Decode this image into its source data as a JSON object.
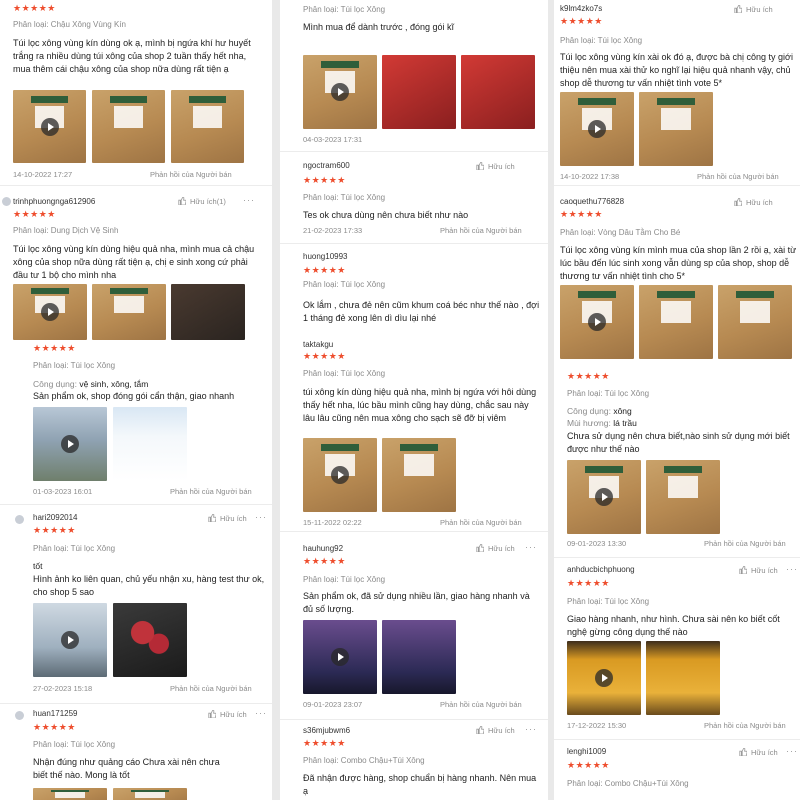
{
  "labels": {
    "category_prefix": "Phân loại:",
    "reply": "Phản hồi của Người bán",
    "helpful": "Hữu ích",
    "use_label": "Công dụng:",
    "scent_label": "Mùi hương:",
    "more": "···",
    "stars": "★★★★★"
  },
  "column1": [
    {
      "user": "",
      "category": "Phân loại: Chậu Xông Vùng Kín",
      "text": "Túi lọc xông vùng kín dùng ok ạ, mình bị ngứa khí hư huyết trắng ra nhiều dùng túi xông của shop 2 tuần thấy hết nha, mua thêm cái chậu xông của shop nữa dùng rất tiện ạ",
      "date": "14-10-2022 17:27",
      "helpful": ""
    },
    {
      "user": "trinhphuongnga612906",
      "category": "Phân loại: Dung Dịch Vệ Sinh",
      "text": "Túi lọc xông vùng kín dùng hiệu quả nha, mình mua cả chậu xông của shop nữa dùng rất tiện ạ, chị e sinh xong cứ phải đầu tư 1 bộ cho mình nha",
      "date": "",
      "helpful": "Hữu ích(1)"
    },
    {
      "user": "",
      "category": "Phân loại: Túi lọc Xông",
      "use": "vệ sinh, xông, tắm",
      "text": "Sản phẩm ok, shop đóng gói cẩn thận, giao nhanh",
      "date": "01-03-2023 16:01",
      "helpful": ""
    },
    {
      "user": "hari2092014",
      "category": "Phân loại: Túi lọc Xông",
      "use": "tốt",
      "text": "Hình ảnh ko liên quan, chủ yếu nhận xu, hàng test thư ok, cho shop 5 sao",
      "date": "27-02-2023 15:18",
      "helpful": "Hữu ích"
    },
    {
      "user": "huan171259",
      "category": "Phân loại: Túi lọc Xông",
      "text": "Nhận đúng như quảng cáo Chưa xài nên chưa biết thế nào. Mong là tốt",
      "date": "",
      "helpful": "Hữu ích"
    }
  ],
  "column2": [
    {
      "user": "",
      "category": "Phân loại: Túi lọc Xông",
      "text": "Mình mua để dành trước , đóng gói kĩ",
      "date": "04-03-2023 17:31",
      "helpful": ""
    },
    {
      "user": "ngoctram600",
      "category": "Phân loại: Túi lọc Xông",
      "text": "Tes ok chưa dùng nên chưa biết như nào",
      "date": "21-02-2023 17:33",
      "helpful": "Hữu ích"
    },
    {
      "user": "huong10993",
      "category": "Phân loại: Túi lọc Xông",
      "text": "Ok lắm , chưa đẻ nên cũm khum coá béc như thế nào , đợi 1 tháng đẻ xong lên dì dìu lại nhé",
      "date": "",
      "helpful": ""
    },
    {
      "user": "taktakgu",
      "category": "Phân loại: Túi lọc Xông",
      "text": "túi xông kín dùng hiệu quả nha, mình bị ngứa với hôi dùng thấy hết nha, lúc bầu mình cũng hay dùng, chắc sau này lâu lâu cũng nên mua xông cho sạch sẽ đỡ bị viêm",
      "date": "15-11-2022 02:22",
      "helpful": ""
    },
    {
      "user": "hauhung92",
      "category": "Phân loại: Túi lọc Xông",
      "text": "Sản phẩm ok, đã sử dụng nhiều lần, giao hàng nhanh và đủ số lượng.",
      "date": "09-01-2023 23:07",
      "helpful": "Hữu ích"
    },
    {
      "user": "s36mjubwm6",
      "category": "Phân loại: Combo Chậu+Túi Xông",
      "text": "Đã nhận được hàng, shop chuẩn bị hàng nhanh. Nên mua ạ",
      "date": "",
      "helpful": "Hữu ích"
    }
  ],
  "column3": [
    {
      "user": "k9lm4zko7s",
      "category": "Phân loại: Túi lọc Xông",
      "text": "Túi lọc xông vùng kín xài ok đó ạ, được bà chị công ty giới thiệu nên mua xài thử ko nghĩ lại hiệu quả nhanh vậy, chủ shop dễ thương tư vấn nhiệt tình vote 5*",
      "date": "14-10-2022 17:38",
      "helpful": "Hữu ích"
    },
    {
      "user": "caoquethu776828",
      "category": "Phân loại: Vòng Dâu Tằm Cho Bé",
      "text": "Túi lọc xông vùng kín mình mua của shop lần 2 rồi ạ, xài từ lúc bầu đến lúc sinh xong vẫn dùng sp của shop, shop dễ thương tư vấn nhiệt tình cho 5*",
      "date": "",
      "helpful": "Hữu ích"
    },
    {
      "user": "",
      "category": "Phân loại: Túi lọc Xông",
      "use": "xông",
      "scent": "lá trầu",
      "text": "Chưa sử dụng nên chưa biết,nào sinh sử dụng mới biết được như thế nào",
      "date": "09-01-2023 13:30",
      "helpful": ""
    },
    {
      "user": "anhducbichphuong",
      "category": "Phân loại: Túi lọc Xông",
      "text": "Giao hàng nhanh, như hình. Chưa sài nên ko biết cốt nghệ gừng công dụng thế nào",
      "date": "17-12-2022 15:30",
      "helpful": "Hữu ích"
    },
    {
      "user": "lenghi1009",
      "category": "Phân loại: Combo Chậu+Túi Xông",
      "text": "",
      "date": "",
      "helpful": "Hữu ích"
    }
  ]
}
